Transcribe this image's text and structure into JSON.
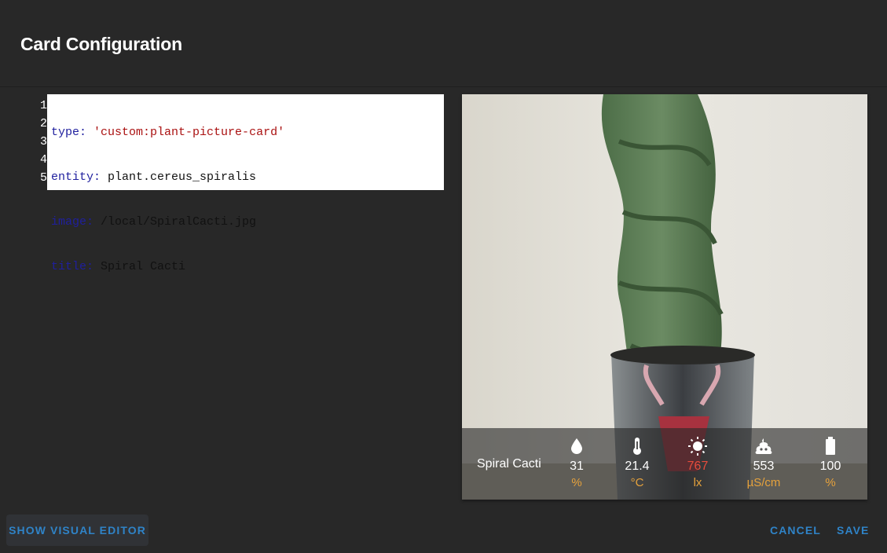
{
  "dialog": {
    "title": "Card Configuration"
  },
  "editor": {
    "line_numbers": [
      "1",
      "2",
      "3",
      "4",
      "5"
    ],
    "lines": [
      {
        "key": "type:",
        "value": "'custom:plant-picture-card'",
        "value_kind": "string"
      },
      {
        "key": "entity:",
        "value": "plant.cereus_spiralis",
        "value_kind": "plain"
      },
      {
        "key": "image:",
        "value": "/local/SpiralCacti.jpg",
        "value_kind": "plain"
      },
      {
        "key": "title:",
        "value": "Spiral Cacti",
        "value_kind": "plain"
      },
      {
        "key": "",
        "value": "",
        "value_kind": "plain"
      }
    ]
  },
  "preview": {
    "plant_name": "Spiral Cacti",
    "sensors": [
      {
        "icon": "water-drop-icon",
        "value": "31",
        "unit": "%",
        "status": "ok"
      },
      {
        "icon": "thermometer-icon",
        "value": "21.4",
        "unit": "°C",
        "status": "ok"
      },
      {
        "icon": "sun-icon",
        "value": "767",
        "unit": "lx",
        "status": "problem"
      },
      {
        "icon": "fertilizer-icon",
        "value": "553",
        "unit": "µS/cm",
        "status": "ok"
      },
      {
        "icon": "battery-icon",
        "value": "100",
        "unit": "%",
        "status": "ok"
      }
    ],
    "colors": {
      "value": "#ffffff",
      "problem": "#e74c3c",
      "unit": "#e6a23c"
    }
  },
  "actions": {
    "visual_editor": "Show Visual Editor",
    "cancel": "Cancel",
    "save": "Save"
  }
}
